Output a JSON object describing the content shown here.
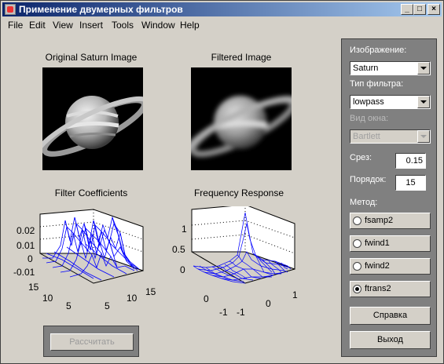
{
  "window": {
    "title": "Применение двумерных фильтров"
  },
  "menu": [
    "File",
    "Edit",
    "View",
    "Insert",
    "Tools",
    "Window",
    "Help"
  ],
  "plots": {
    "original_title": "Original Saturn Image",
    "filtered_title": "Filtered Image",
    "coef_title": "Filter Coefficients",
    "freq_title": "Frequency Response",
    "coef_z_ticks": [
      "0.02",
      "0.01",
      "0",
      "-0.01"
    ],
    "coef_y_ticks": [
      "15",
      "10",
      "5"
    ],
    "coef_x_ticks": [
      "5",
      "10",
      "15"
    ],
    "freq_z_ticks": [
      "1",
      "0.5",
      "0"
    ],
    "freq_y_ticks": [
      "0",
      "-1"
    ],
    "freq_x_ticks": [
      "-1",
      "0",
      "1"
    ]
  },
  "controls": {
    "image_label": "Изображение:",
    "image_value": "Saturn",
    "filter_type_label": "Тип фильтра:",
    "filter_type_value": "lowpass",
    "window_label": "Вид окна:",
    "window_value": "Bartlett",
    "cutoff_label": "Срез:",
    "cutoff_value": "0.15",
    "order_label": "Порядок:",
    "order_value": "15",
    "method_label": "Метод:",
    "methods": [
      "fsamp2",
      "fwind1",
      "fwind2",
      "ftrans2"
    ],
    "selected_method": "ftrans2",
    "help_button": "Справка",
    "exit_button": "Выход",
    "compute_button": "Рассчитать"
  },
  "colors": {
    "title_start": "#0a246a",
    "title_end": "#a6caf0",
    "panel": "#808080",
    "mesh": "#0000ff"
  }
}
